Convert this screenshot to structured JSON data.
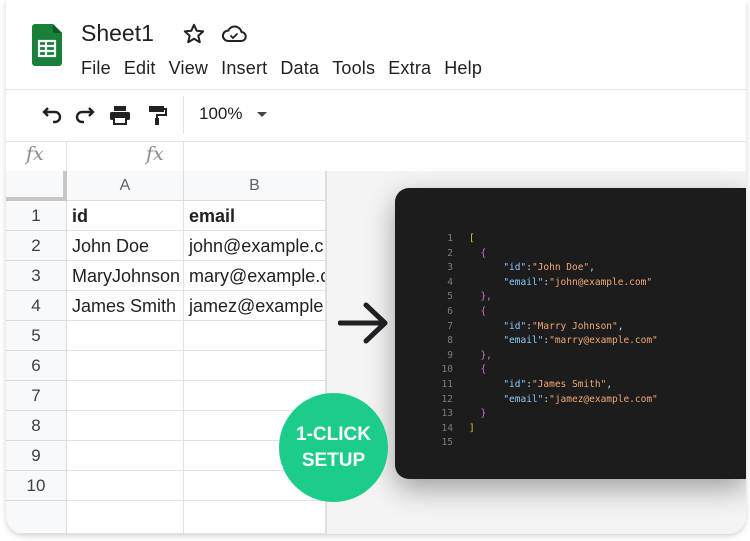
{
  "doc": {
    "title": "Sheet1"
  },
  "menu": [
    "File",
    "Edit",
    "View",
    "Insert",
    "Data",
    "Tools",
    "Extra",
    "Help"
  ],
  "toolbar": {
    "icons": [
      "undo-icon",
      "redo-icon",
      "print-icon",
      "paint-format-icon"
    ],
    "zoom": "100%"
  },
  "formula_bar": {
    "fx_label": "fx",
    "fx_label2": "fx"
  },
  "sheet": {
    "columns": [
      "A",
      "B"
    ],
    "rows": [
      "1",
      "2",
      "3",
      "4",
      "5",
      "6",
      "7",
      "8",
      "9",
      "10"
    ],
    "cells": [
      [
        "id",
        "email"
      ],
      [
        "John Doe",
        "john@example.c"
      ],
      [
        "MaryJohnson",
        "mary@example.c"
      ],
      [
        "James Smith",
        "jamez@example"
      ]
    ]
  },
  "json_preview": {
    "line_numbers": [
      "1",
      "2",
      "3",
      "4",
      "5",
      "6",
      "7",
      "8",
      "9",
      "10",
      "11",
      "12",
      "13",
      "14",
      "15"
    ],
    "lines": [
      "[",
      "{",
      "\"id\":\"John Doe\",",
      "\"email\":\"john@example.com\"",
      "},",
      "{",
      "\"id\":\"Marry Johnson\",",
      "\"email\":\"marry@example.com\"",
      "},",
      "{",
      "\"id\":\"James Smith\",",
      "\"email\":\"jamez@example.com\"",
      "}",
      "]",
      ""
    ]
  },
  "badge": {
    "line1": "1-CLICK",
    "line2": "SETUP"
  },
  "colors": {
    "sheets_green": "#188038",
    "badge_green": "#1ccc8a",
    "code_bg": "#1c1c1c"
  }
}
